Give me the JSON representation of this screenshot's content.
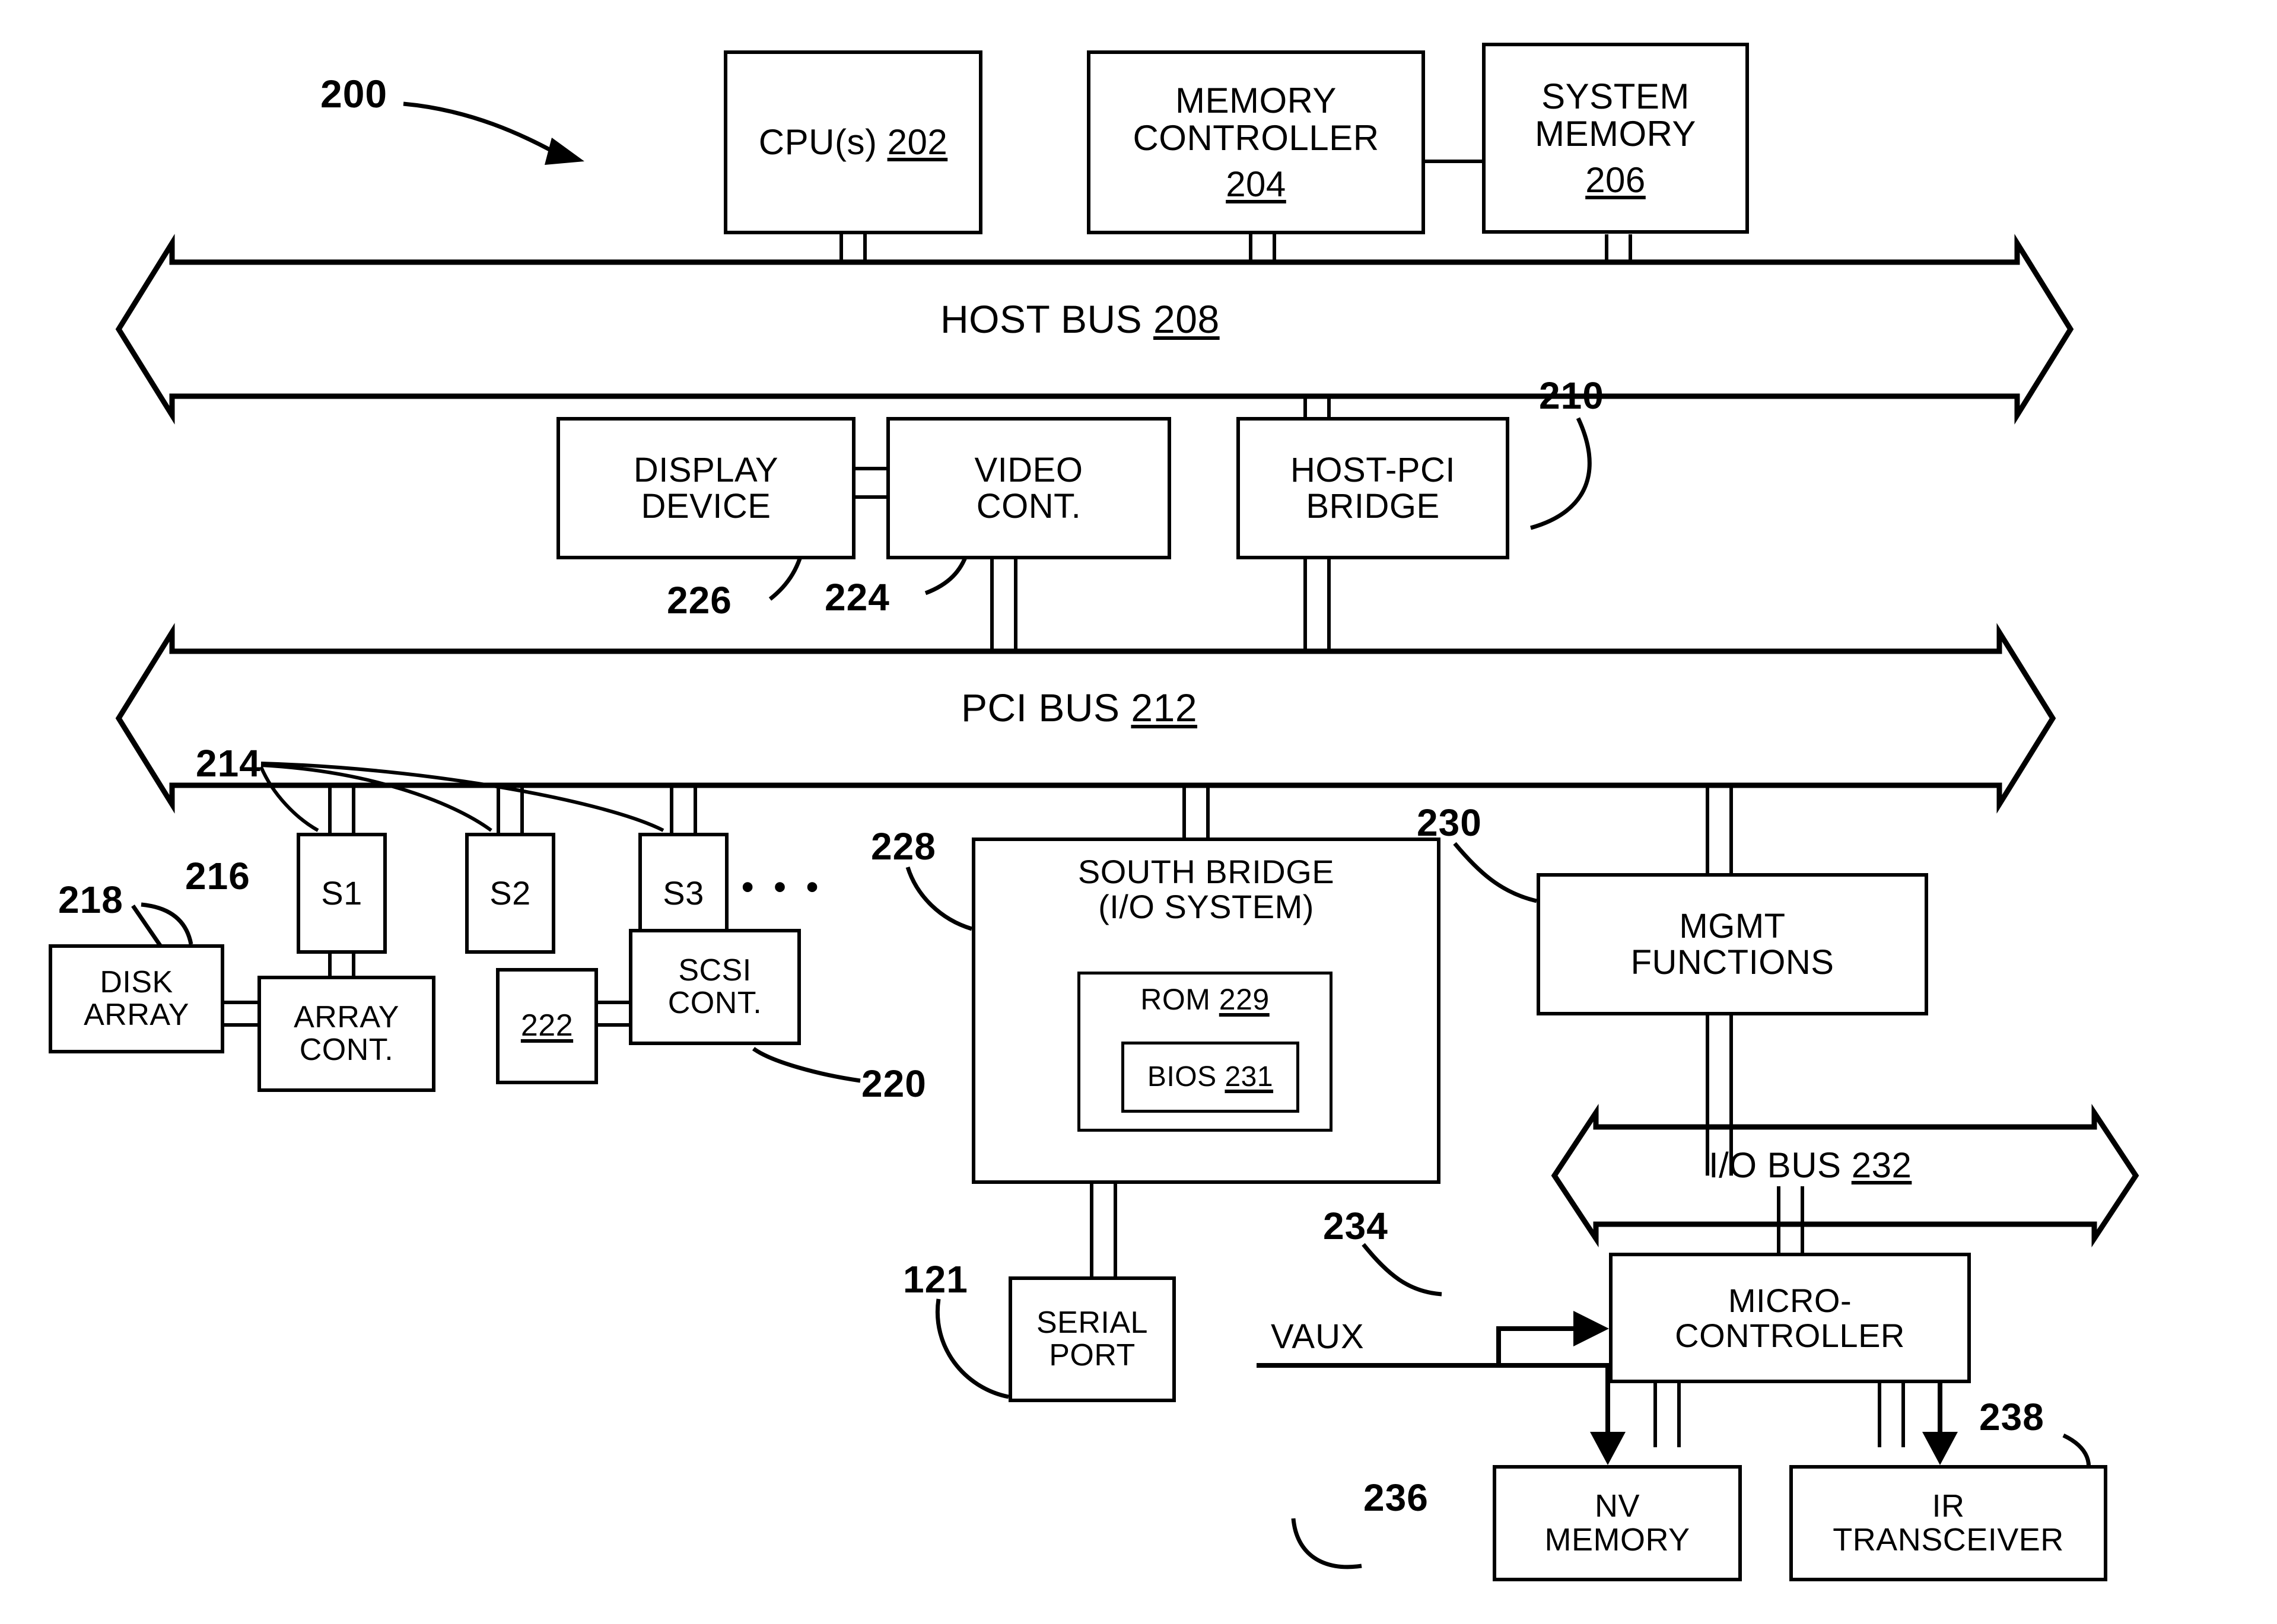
{
  "figure": {
    "system_ref": "200",
    "colors": {
      "ink": "#000000",
      "paper": "#ffffff"
    }
  },
  "blocks": {
    "cpu": {
      "lines": [
        "CPU(s) 202"
      ],
      "ref": "202"
    },
    "mem_ctrl": {
      "lines": [
        "MEMORY",
        "CONTROLLER",
        "204"
      ],
      "ref": "204"
    },
    "sys_mem": {
      "lines": [
        "SYSTEM",
        "MEMORY",
        "206"
      ],
      "ref": "206"
    },
    "display": {
      "lines": [
        "DISPLAY",
        "DEVICE"
      ],
      "ref": "226"
    },
    "video": {
      "lines": [
        "VIDEO",
        "CONT."
      ],
      "ref": "224"
    },
    "host_pci": {
      "lines": [
        "HOST-PCI",
        "BRIDGE"
      ],
      "ref": "210"
    },
    "slot1": {
      "lines": [
        "S1"
      ]
    },
    "slot2": {
      "lines": [
        "S2"
      ]
    },
    "slot3": {
      "lines": [
        "S3"
      ]
    },
    "disk_array": {
      "lines": [
        "DISK",
        "ARRAY"
      ],
      "ref": "218"
    },
    "array_cont": {
      "lines": [
        "ARRAY",
        "CONT."
      ],
      "ref": "216"
    },
    "disk_222": {
      "lines": [
        "222"
      ],
      "ref": "222"
    },
    "scsi_cont": {
      "lines": [
        "SCSI",
        "CONT."
      ],
      "ref": "220"
    },
    "south_bridge": {
      "lines": [
        "SOUTH  BRIDGE",
        "(I/O SYSTEM)"
      ],
      "ref": "228"
    },
    "rom": {
      "lines": [
        "ROM 229"
      ],
      "ref": "229"
    },
    "bios": {
      "lines": [
        "BIOS 231"
      ],
      "ref": "231"
    },
    "mgmt": {
      "lines": [
        "MGMT",
        "FUNCTIONS"
      ],
      "ref": "230"
    },
    "serial_port": {
      "lines": [
        "SERIAL",
        "PORT"
      ],
      "ref": "121"
    },
    "micro": {
      "lines": [
        "MICRO-",
        "CONTROLLER"
      ],
      "ref": "234"
    },
    "nv_mem": {
      "lines": [
        "NV",
        "MEMORY"
      ],
      "ref": "236"
    },
    "ir": {
      "lines": [
        "IR",
        "TRANSCEIVER"
      ],
      "ref": "238"
    }
  },
  "buses": {
    "host": {
      "label_text": "HOST BUS ",
      "label_ref": "208"
    },
    "pci": {
      "label_text": "PCI BUS ",
      "label_ref": "212"
    },
    "io": {
      "label_text": "I/O BUS ",
      "label_ref": "232"
    }
  },
  "signals": {
    "vaux": "VAUX"
  },
  "refnums": {
    "system": "200",
    "cpu": "202",
    "mem_ctrl": "204",
    "sys_mem": "206",
    "host_bus": "208",
    "host_pci_bridge": "210",
    "pci_bus": "212",
    "slots": "214",
    "array_cont": "216",
    "disk_array": "218",
    "scsi_cont": "220",
    "disk_222": "222",
    "video_cont": "224",
    "display_device": "226",
    "south_bridge": "228",
    "rom": "229",
    "mgmt_functions": "230",
    "bios": "231",
    "io_bus": "232",
    "microcontroller": "234",
    "nv_memory": "236",
    "ir_transceiver": "238",
    "serial_port": "121"
  },
  "misc": {
    "ellipsis": "• • •"
  }
}
